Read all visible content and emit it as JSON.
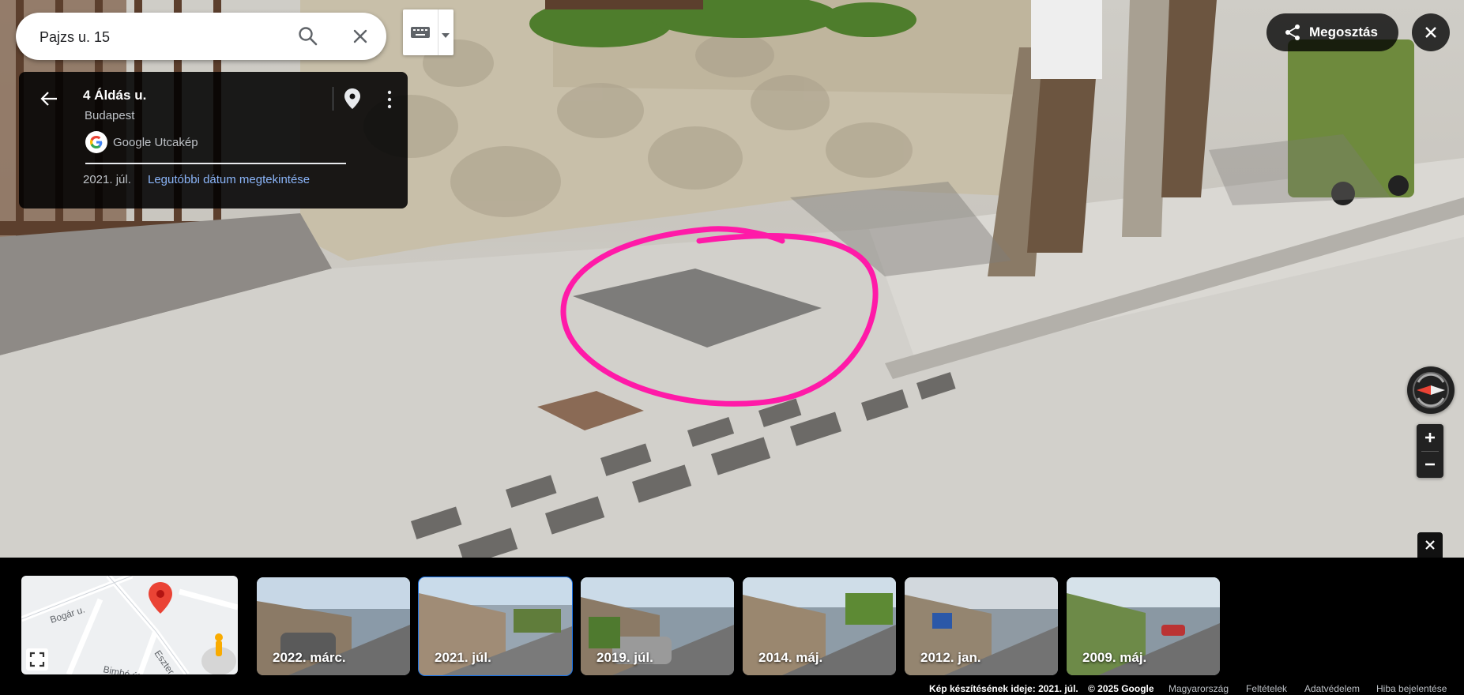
{
  "search": {
    "value": "Pajzs u. 15",
    "search_icon": "search-icon",
    "clear_icon": "close-icon"
  },
  "keyboard": {
    "icon": "keyboard-icon"
  },
  "card": {
    "title": "4 Áldás u.",
    "city": "Budapest",
    "provider": "Google Utcakép",
    "date": "2021. júl.",
    "link": "Legutóbbi dátum megtekintése"
  },
  "share": {
    "label": "Megosztás"
  },
  "minimap": {
    "streets": [
      "Bogár u.",
      "Eszter u.",
      "Bimbó út"
    ]
  },
  "timeline": [
    {
      "label": "2022. márc.",
      "selected": false
    },
    {
      "label": "2021. júl.",
      "selected": true
    },
    {
      "label": "2019. júl.",
      "selected": false
    },
    {
      "label": "2014. máj.",
      "selected": false
    },
    {
      "label": "2012. jan.",
      "selected": false
    },
    {
      "label": "2009. máj.",
      "selected": false
    }
  ],
  "footer": {
    "capture_date": "Kép készítésének ideje: 2021. júl.",
    "copyright": "© 2025 Google",
    "country": "Magyarország",
    "terms": "Feltételek",
    "privacy": "Adatvédelem",
    "report": "Hiba bejelentése"
  },
  "colors": {
    "annotation": "#ff1aa8",
    "accent": "#1a73e8",
    "link": "#8ab4f8"
  }
}
